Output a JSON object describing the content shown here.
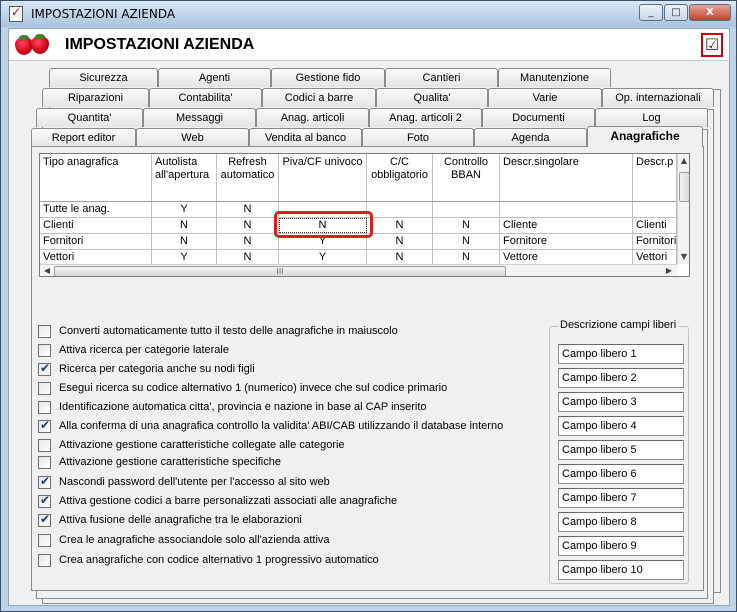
{
  "window": {
    "title": "IMPOSTAZIONI AZIENDA",
    "controls": [
      "_",
      "□",
      "X"
    ]
  },
  "header": {
    "title": "IMPOSTAZIONI AZIENDA"
  },
  "tabs": {
    "row1": [
      "Sicurezza",
      "Agenti",
      "Gestione fido",
      "Cantieri",
      "Manutenzione"
    ],
    "row2": [
      "Riparazioni",
      "Contabilita'",
      "Codici a barre",
      "Qualita'",
      "Varie",
      "Op. internazionali"
    ],
    "row3": [
      "Quantita'",
      "Messaggi",
      "Anag. articoli",
      "Anag. articoli 2",
      "Documenti",
      "Log"
    ],
    "row4": [
      "Report editor",
      "Web",
      "Vendita al banco",
      "Foto",
      "Agenda",
      "Anagrafiche"
    ],
    "active": "Anagrafiche"
  },
  "grid": {
    "headers": [
      "Tipo anagrafica",
      "Autolista all'apertura",
      "Refresh automatico",
      "Piva/CF univoco",
      "C/C obbligatorio",
      "Controllo BBAN",
      "Descr.singolare",
      "Descr.p"
    ],
    "rows": [
      [
        "Tutte le anag.",
        "Y",
        "N",
        "",
        "",
        "",
        "",
        ""
      ],
      [
        "Clienti",
        "N",
        "N",
        "N",
        "N",
        "N",
        "Cliente",
        "Clienti"
      ],
      [
        "Fornitori",
        "N",
        "N",
        "Y",
        "N",
        "N",
        "Fornitore",
        "Fornitori"
      ],
      [
        "Vettori",
        "Y",
        "N",
        "Y",
        "N",
        "N",
        "Vettore",
        "Vettori"
      ]
    ],
    "scroll_grip": "III"
  },
  "options": [
    {
      "label": "Converti automaticamente tutto il testo delle anagrafiche in maiuscolo",
      "checked": false
    },
    {
      "label": "Attiva ricerca per categorie laterale",
      "checked": false
    },
    {
      "label": "Ricerca per categoria anche su nodi figli",
      "checked": true
    },
    {
      "label": "Esegui ricerca su codice alternativo 1 (numerico) invece che sul codice primario",
      "checked": false
    },
    {
      "label": "Identificazione automatica citta', provincia e nazione in base al CAP inserito",
      "checked": false
    },
    {
      "label": "Alla conferma di una anagrafica controllo la validita' ABI/CAB utilizzando il database interno",
      "checked": true
    },
    {
      "label": "Attivazione gestione caratteristiche collegate alle categorie",
      "checked": false
    },
    {
      "label": "Attivazione gestione caratteristiche specifiche",
      "checked": false
    },
    {
      "label": "Nascondi password dell'utente per l'accesso al sito web",
      "checked": true
    },
    {
      "label": "Attiva gestione codici a barre personalizzati associati alle anagrafiche",
      "checked": true
    },
    {
      "label": "Attiva fusione delle anagrafiche tra le elaborazioni",
      "checked": true
    },
    {
      "label": "Crea le anagrafiche associandole solo all'azienda attiva",
      "checked": false
    },
    {
      "label": "Crea anagrafiche con codice alternativo 1 progressivo automatico",
      "checked": false
    }
  ],
  "free_fields": {
    "legend": "Descrizione campi liberi",
    "values": [
      "Campo libero 1",
      "Campo libero 2",
      "Campo libero 3",
      "Campo libero 4",
      "Campo libero 5",
      "Campo libero 6",
      "Campo libero 7",
      "Campo libero 8",
      "Campo libero 9",
      "Campo libero 10"
    ]
  },
  "colors": {
    "highlight": "#e21d1d",
    "title_bar": "#bcd3e8",
    "checkmark": "#1a3a8a"
  }
}
